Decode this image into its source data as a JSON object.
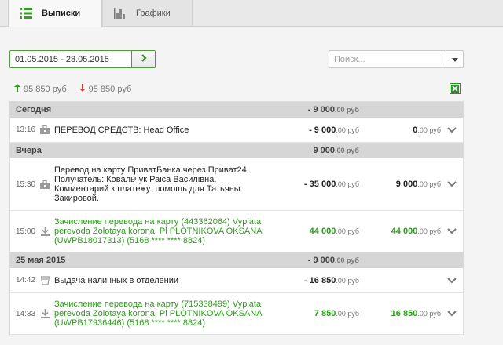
{
  "tabs": [
    {
      "label": "Выписки",
      "active": true
    },
    {
      "label": "Графики",
      "active": false
    }
  ],
  "filters": {
    "date_range": "01.05.2015 - 28.05.2015",
    "search_placeholder": "Поиск..."
  },
  "totals": {
    "income": "95 850 руб",
    "expense": "95 850 руб",
    "income_color": "#3a9a2a",
    "expense_color": "#d23c3c"
  },
  "groups": [
    {
      "label": "Сегодня",
      "total_big": "- 9 000",
      "total_small": ".00 руб",
      "rows": [
        {
          "time": "13:16",
          "icon": "briefcase-icon",
          "lines": [
            "ПЕРЕВОД СРЕДСТВ: Head Office"
          ],
          "green": false,
          "amount_big": "- 9 000",
          "amount_small": ".00 руб",
          "balance_big": "0",
          "balance_small": ".00 руб"
        }
      ]
    },
    {
      "label": "Вчера",
      "total_big": "9 000",
      "total_small": ".00 руб",
      "rows": [
        {
          "time": "15:30",
          "icon": "briefcase-icon",
          "lines": [
            "Перевод на карту ПриватБанка через Приват24.",
            "Получатель: Ковальчук Раіса Василівна.",
            "Комментарий к платежу: помощь для Татьяны",
            "Закировой."
          ],
          "green": false,
          "amount_big": "- 35 000",
          "amount_small": ".00 руб",
          "balance_big": "9 000",
          "balance_small": ".00 руб"
        },
        {
          "time": "15:00",
          "icon": "download-icon",
          "lines": [
            "Зачисление перевода на карту (443362064) Vyplata",
            "perevoda Zolotaya korona. Pl PLOTNIKOVA OKSANA",
            "(UWPB18017313) (5168 **** **** 8824)"
          ],
          "green": true,
          "amount_big": "44 000",
          "amount_small": ".00 руб",
          "balance_big": "44 000",
          "balance_small": ".00 руб"
        }
      ]
    },
    {
      "label": "25 мая 2015",
      "total_big": "- 9 000",
      "total_small": ".00 руб",
      "rows": [
        {
          "time": "14:42",
          "icon": "cup-icon",
          "lines": [
            "Выдача наличных в отделении"
          ],
          "green": false,
          "amount_big": "- 16 850",
          "amount_small": ".00 руб",
          "balance_big": "",
          "balance_small": ""
        },
        {
          "time": "14:33",
          "icon": "download-icon",
          "lines": [
            "Зачисление перевода на карту (715338499) Vyplata",
            "perevoda Zolotaya korona. Pl PLOTNIKOVA OKSANA",
            "(UWPB17936446) (5168 **** **** 8824)"
          ],
          "green": true,
          "amount_big": "7 850",
          "amount_small": ".00 руб",
          "balance_big": "16 850",
          "balance_small": ".00 руб"
        }
      ]
    }
  ]
}
